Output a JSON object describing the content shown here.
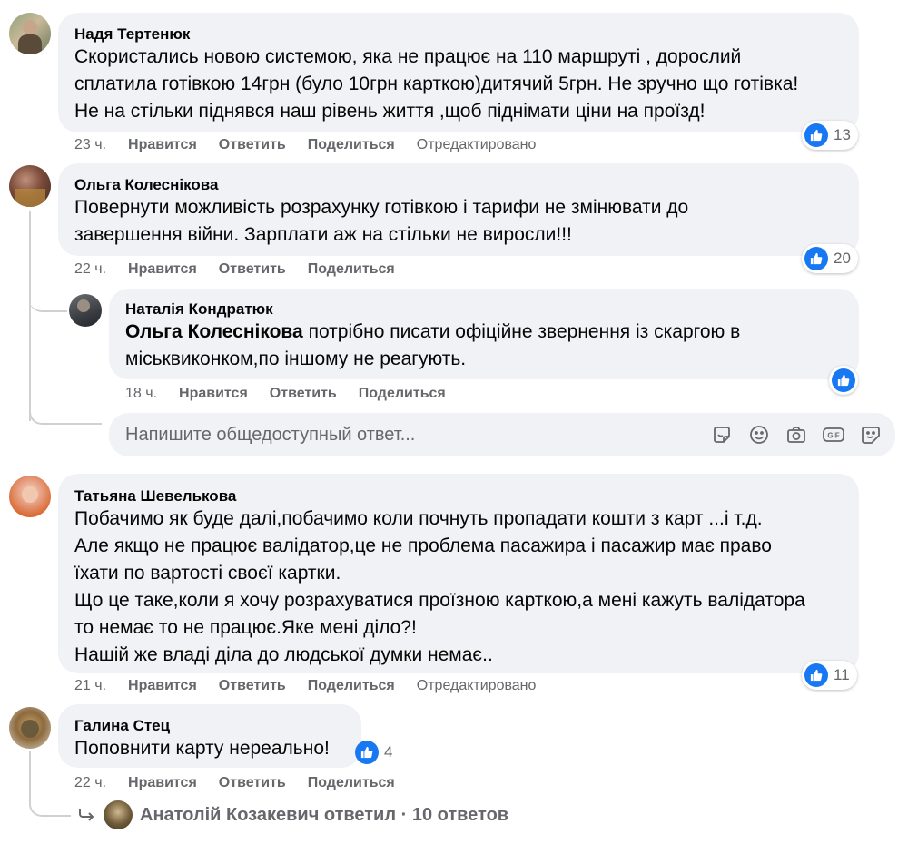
{
  "comments": [
    {
      "author": "Надя Тертенюк",
      "text": "Скористались новою системою, яка не працює на 110 маршруті , дорослий\nсплатила готівкою 14грн (було 10грн карткою)дитячий 5грн. Не зручно що готівка!\nНе на стільки піднявся наш рівень життя ,щоб піднімати ціни на проїзд!",
      "time": "23 ч.",
      "edited": "Отредактировано",
      "likes": "13"
    },
    {
      "author": "Ольга Колеснікова",
      "text": "Повернути можливість розрахунку готівкою і тарифи не змінювати до\nзавершення війни. Зарплати аж на стільки не виросли!!!",
      "time": "22 ч.",
      "likes": "20"
    },
    {
      "author": "Наталія Кондратюк",
      "mention": "Ольга Колеснікова",
      "text": " потрібно писати офіційне звернення із скаргою в\nміськвиконкoм,по іншому не реагують.",
      "time": "18 ч."
    },
    {
      "author": "Татьяна Шевелькова",
      "text": "Побачимо як буде далі,побачимо коли почнуть пропадати кошти з карт ...і т.д.\nАле якщо не працює валідатор,це не проблема пасажира і пасажир має право\nїхати по вартості своєї картки.\nЩо це таке,коли я хочу розрахуватися проїзною карткою,а мені кажуть валідатора\nто немає то не працює.Яке мені діло?!\nНашій же владі діла до людської думки немає..",
      "time": "21 ч.",
      "edited": "Отредактировано",
      "likes": "11"
    },
    {
      "author": "Галина Стец",
      "text": "Поповнити карту нереально!",
      "time": "22 ч.",
      "likes": "4"
    }
  ],
  "actions": {
    "like": "Нравится",
    "reply": "Ответить",
    "share": "Поделиться"
  },
  "reply_box": {
    "placeholder": "Напишите общедоступный ответ..."
  },
  "more_replies": {
    "text": "Анатолій Козакевич ответил · 10 ответов"
  },
  "icons": [
    "like-icon",
    "sticker-icon",
    "emoji-icon",
    "camera-icon",
    "gif-icon",
    "avatar-sticker-icon",
    "reply-arrow-icon"
  ],
  "colors": {
    "accent": "#1877f2",
    "bubble": "#f0f2f5",
    "secondary_text": "#65676b"
  }
}
